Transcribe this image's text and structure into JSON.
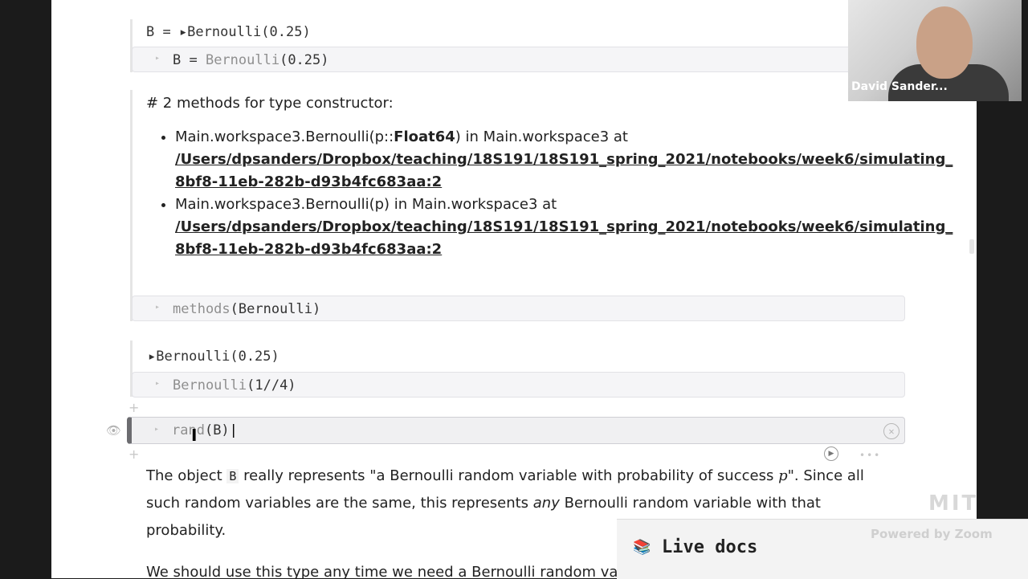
{
  "webcam": {
    "name": "David Sander..."
  },
  "cells": {
    "c1_output": "B = ▸Bernoulli(0.25)",
    "c1_code_lhs": "B = ",
    "c1_code_fn": "Bernoulli",
    "c1_code_args": "(0.25)",
    "methods_header": "# 2 methods for type constructor:",
    "method1_sig_pre": "Main.workspace3.Bernoulli(p::",
    "method1_sig_type": "Float64",
    "method1_sig_post": ") in Main.workspace3 at",
    "method1_path_line1": "/Users/dpsanders/Dropbox/teaching/18S191/18S191_spring_2021/notebooks/week6/simulating_",
    "method1_path_line2": "8bf8-11eb-282b-d93b4fc683aa:2",
    "method2_sig": "Main.workspace3.Bernoulli(p) in Main.workspace3 at",
    "method2_path_line1": "/Users/dpsanders/Dropbox/teaching/18S191/18S191_spring_2021/notebooks/week6/simulating_",
    "method2_path_line2": "8bf8-11eb-282b-d93b4fc683aa:2",
    "c2_code_fn": "methods",
    "c2_code_args": "(Bernoulli)",
    "c3_output": "▸Bernoulli(0.25)",
    "c3_code_fn": "Bernoulli",
    "c3_code_args": "(1//4)",
    "c4_code_fn": "rand",
    "c4_code_args": "(B)"
  },
  "markdown": {
    "para1_a": "The object ",
    "para1_code": "B",
    "para1_b": " really represents \"a Bernoulli random variable with probability of success ",
    "para1_math": "p",
    "para1_c": "\". Since all such random variables are the same, this represents ",
    "para1_em": "any",
    "para1_d": " Bernoulli random variable with that probability.",
    "para2": "We should use this type any time we need a Bernoulli random va"
  },
  "live_docs": {
    "label": "Live docs",
    "icon": "book-icon"
  },
  "overlay": {
    "watermark": "Powered by Zoom",
    "logo": "MIT"
  }
}
